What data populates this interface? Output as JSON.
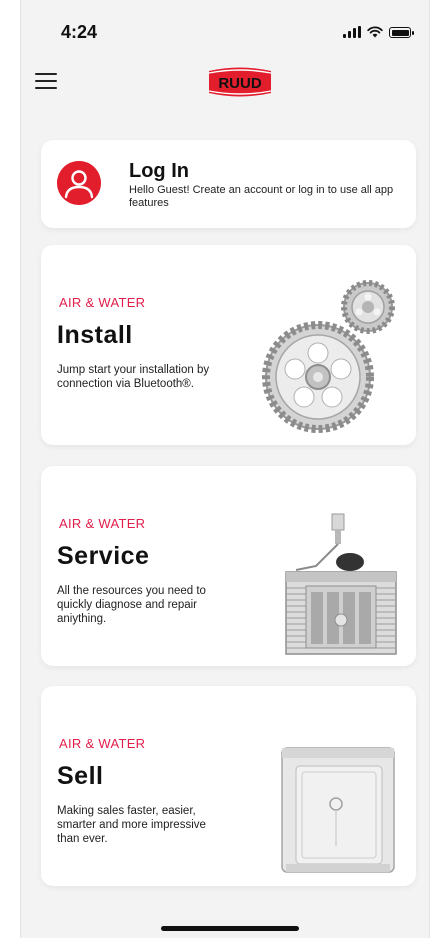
{
  "status_bar": {
    "time": "4:24"
  },
  "header": {
    "logo_text": "RUUD",
    "brand_color": "#e21e2c"
  },
  "login_card": {
    "title": "Log In",
    "subtitle": "Hello Guest! Create an account or log in to use all app features"
  },
  "features": [
    {
      "eyebrow": "AIR & WATER",
      "title": "Install",
      "description": "Jump start your installation by connection via Bluetooth®.",
      "icon": "gears-icon"
    },
    {
      "eyebrow": "AIR & WATER",
      "title": "Service",
      "description": "All the resources you need to quickly diagnose and repair aniything.",
      "icon": "hvac-unit-icon"
    },
    {
      "eyebrow": "AIR & WATER",
      "title": "Sell",
      "description": "Making sales faster, easier, smarter and more impressive than ever.",
      "icon": "water-heater-cabinet-icon"
    }
  ],
  "colors": {
    "accent": "#e21e4b",
    "background": "#f3f3f3",
    "card": "#ffffff"
  }
}
